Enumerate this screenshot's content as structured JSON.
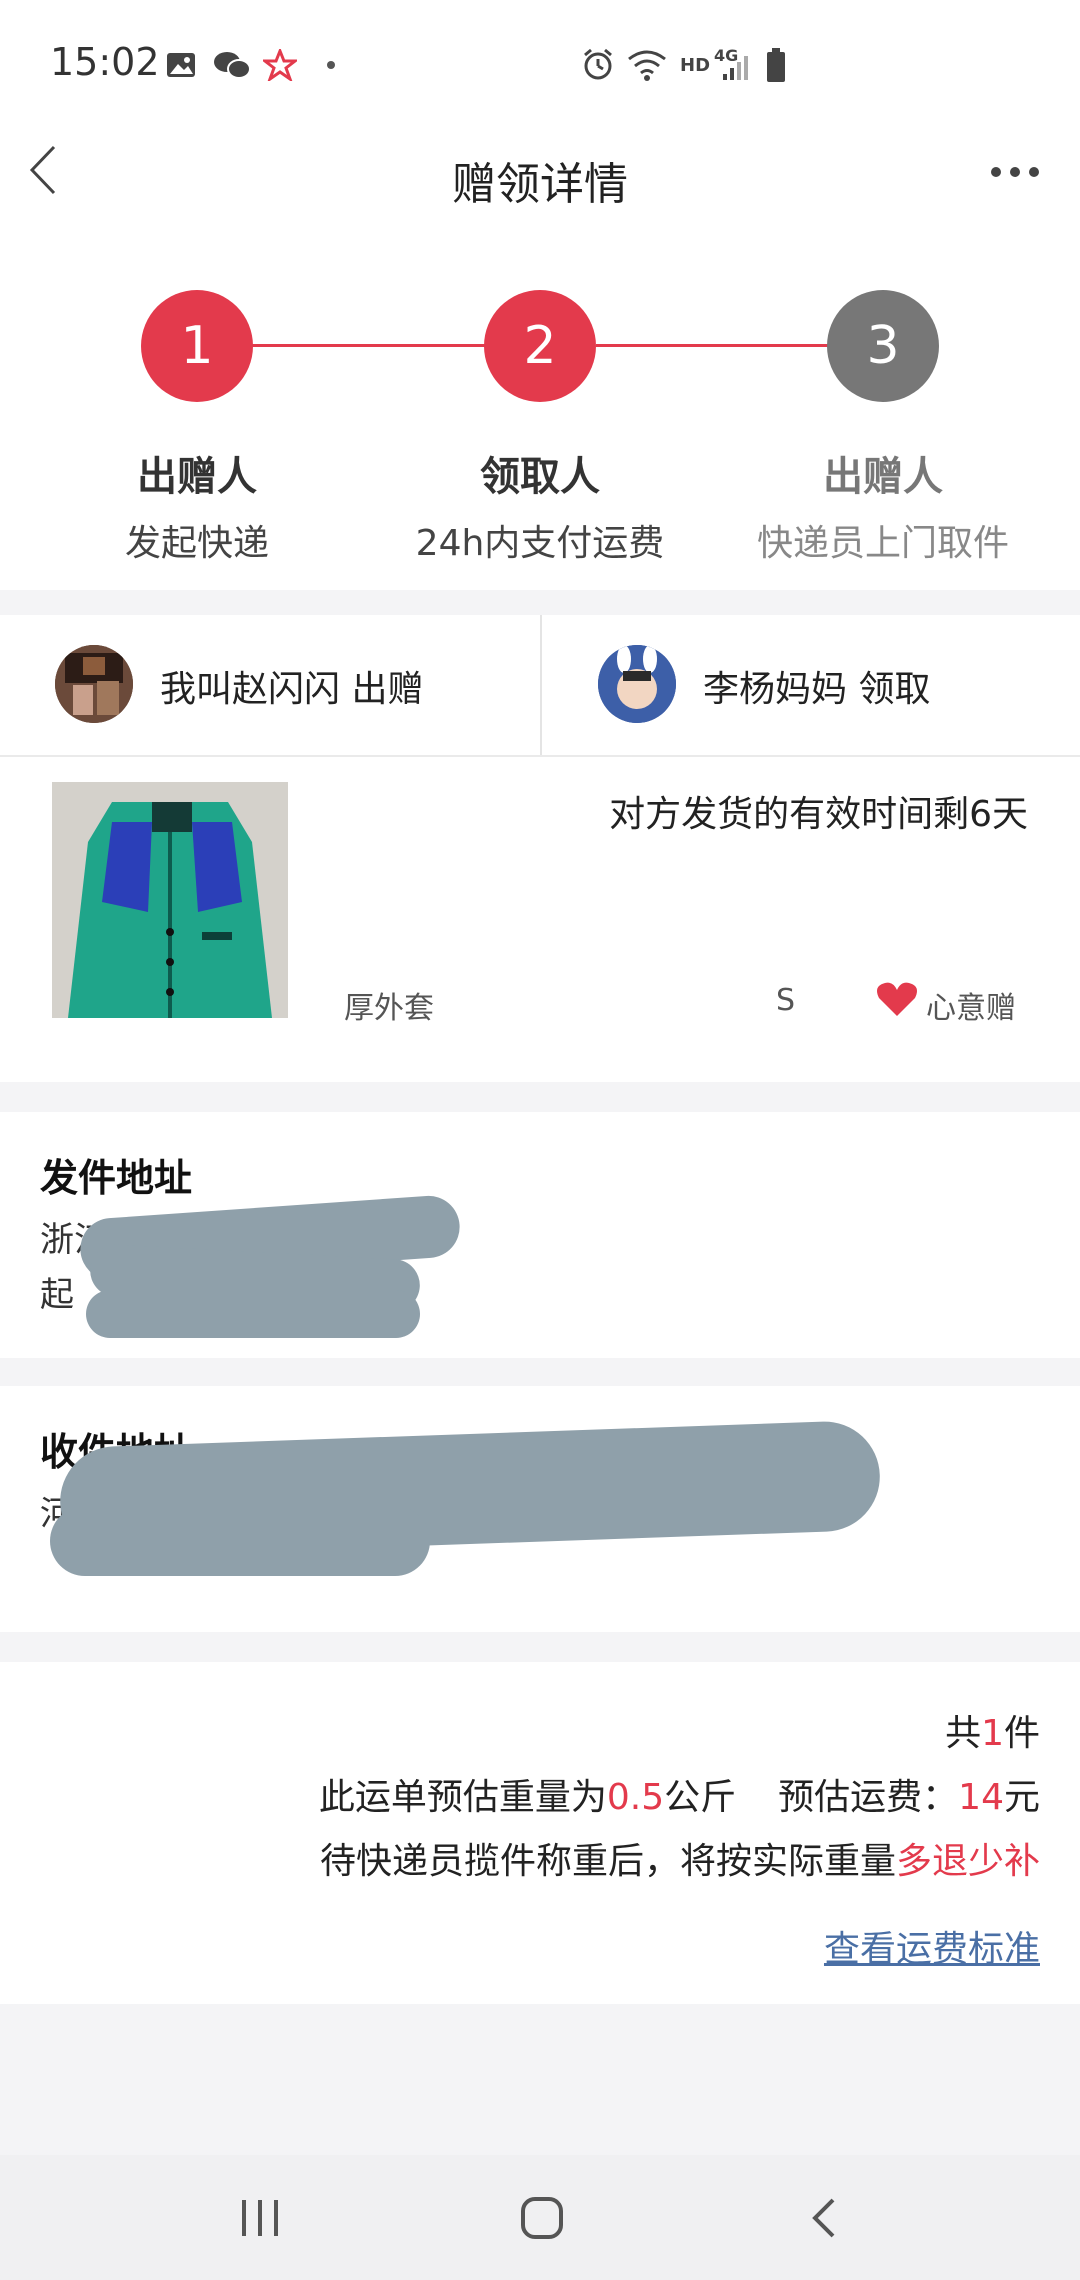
{
  "status": {
    "time": "15:02",
    "network_text": "HD",
    "network_gen": "4G"
  },
  "nav": {
    "title": "赠领详情"
  },
  "steps": [
    {
      "num": "1",
      "title": "出赠人",
      "sub": "发起快递",
      "active": true
    },
    {
      "num": "2",
      "title": "领取人",
      "sub": "24h内支付运费",
      "active": true
    },
    {
      "num": "3",
      "title": "出赠人",
      "sub": "快递员上门取件",
      "active": false
    }
  ],
  "colors": {
    "accent": "#e33a4c",
    "inactive": "#777777",
    "link": "#4a6fa5"
  },
  "people": {
    "giver": "我叫赵闪闪 出赠",
    "receiver": "李杨妈妈 领取"
  },
  "item": {
    "remaining": "对方发货的有效时间剩6天",
    "name": "厚外套",
    "size": "S",
    "tag": "心意赠"
  },
  "sender": {
    "title": "发件地址",
    "line1": "浙江",
    "line2": "起"
  },
  "receiver_addr": {
    "title": "收件地址",
    "line1": "河",
    "line2": ""
  },
  "fee": {
    "count_pre": "共",
    "count": "1",
    "count_post": "件",
    "weight_pre": "此运单预估重量为",
    "weight": "0.5",
    "weight_unit": "公斤",
    "fee_label": "预估运费：",
    "fee_value": "14",
    "fee_unit": "元",
    "note_pre": "待快递员揽件称重后，将按实际重量",
    "note_red": "多退少补",
    "link": "查看运费标准"
  }
}
